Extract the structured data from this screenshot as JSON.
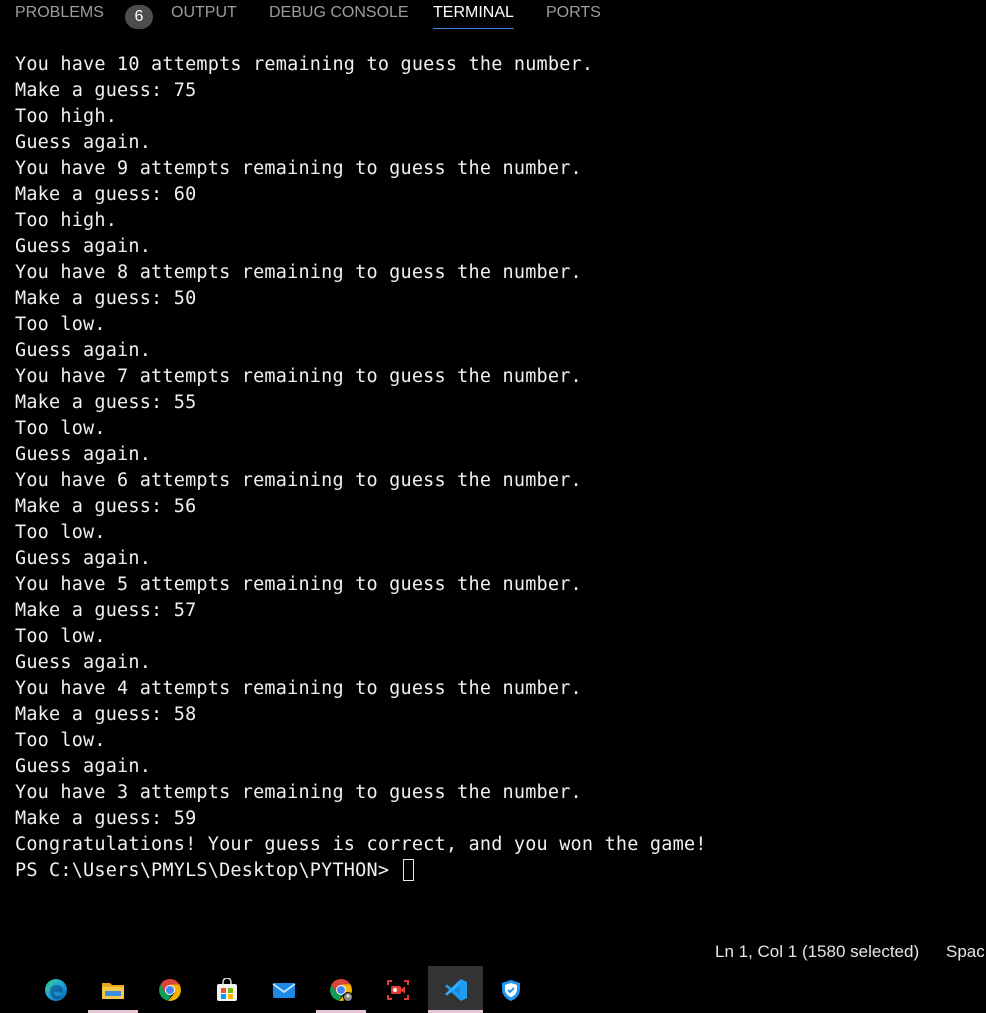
{
  "panel_tabs": [
    {
      "label": "PROBLEMS",
      "badge": "6"
    },
    {
      "label": "OUTPUT"
    },
    {
      "label": "DEBUG CONSOLE"
    },
    {
      "label": "TERMINAL",
      "active": true
    },
    {
      "label": "PORTS"
    }
  ],
  "terminal": {
    "lines": [
      "You have 10 attempts remaining to guess the number.",
      "Make a guess: 75",
      "Too high.",
      "Guess again.",
      "You have 9 attempts remaining to guess the number.",
      "Make a guess: 60",
      "Too high.",
      "Guess again.",
      "You have 8 attempts remaining to guess the number.",
      "Make a guess: 50",
      "Too low.",
      "Guess again.",
      "You have 7 attempts remaining to guess the number.",
      "Make a guess: 55",
      "Too low.",
      "Guess again.",
      "You have 6 attempts remaining to guess the number.",
      "Make a guess: 56",
      "Too low.",
      "Guess again.",
      "You have 5 attempts remaining to guess the number.",
      "Make a guess: 57",
      "Too low.",
      "Guess again.",
      "You have 4 attempts remaining to guess the number.",
      "Make a guess: 58",
      "Too low.",
      "Guess again.",
      "You have 3 attempts remaining to guess the number.",
      "Make a guess: 59",
      "Congratulations! Your guess is correct, and you won the game!"
    ],
    "prompt": "PS C:\\Users\\PMYLS\\Desktop\\PYTHON> "
  },
  "status_bar": {
    "cursor_position": "Ln 1, Col 1 (1580 selected)",
    "indentation": "Spac"
  },
  "taskbar": {
    "items": [
      {
        "name": "edge-icon"
      },
      {
        "name": "file-explorer-icon",
        "running": true
      },
      {
        "name": "chrome-icon"
      },
      {
        "name": "microsoft-store-icon"
      },
      {
        "name": "mail-icon"
      },
      {
        "name": "chrome-profile-icon",
        "running": true
      },
      {
        "name": "screen-recorder-icon"
      },
      {
        "name": "vscode-icon",
        "running": true,
        "active": true
      },
      {
        "name": "security-shield-icon"
      }
    ]
  },
  "colors": {
    "background": "#000000",
    "terminal_text": "#f0f0f0",
    "active_tab_underline": "#3c86d8",
    "running_indicator": "#e7c6d6"
  }
}
